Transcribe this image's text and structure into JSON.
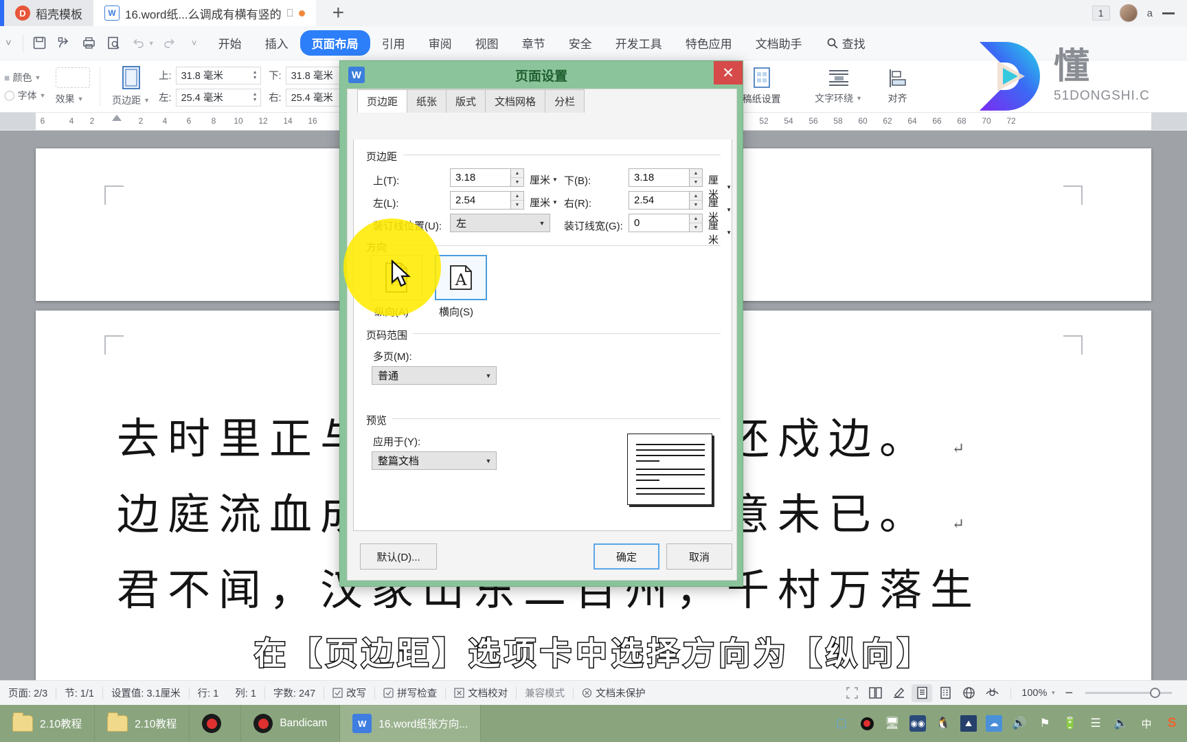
{
  "tabbar": {
    "brand_tab": "稻壳模板",
    "doc_tab": "16.word纸...么调成有横有竖的",
    "new_tab_label": "+",
    "notif_count": "1",
    "user_label": "a"
  },
  "ribbon": {
    "tabs": [
      "开始",
      "插入",
      "页面布局",
      "引用",
      "审阅",
      "视图",
      "章节",
      "安全",
      "开发工具",
      "特色应用",
      "文档助手"
    ],
    "active_tab": "页面布局",
    "find_label": "查找"
  },
  "ribbon_body": {
    "color_label": "颜色",
    "font_label": "字体",
    "effect_label": "效果",
    "margin_button": "页边距",
    "top_label": "上:",
    "top_value": "31.8 毫米",
    "bottom_label": "下:",
    "bottom_value": "31.8 毫米",
    "left_label": "左:",
    "left_value": "25.4 毫米",
    "right_label": "右:",
    "right_value": "25.4 毫米",
    "paper_setup": "稿纸设置",
    "text_wrap": "文字环绕",
    "align": "对齐"
  },
  "ruler": {
    "ticks": [
      "6",
      "4",
      "2",
      "2",
      "4",
      "6",
      "8",
      "10",
      "12",
      "14",
      "16",
      "52",
      "54",
      "56",
      "58",
      "60",
      "62",
      "64",
      "66",
      "68",
      "70",
      "72"
    ]
  },
  "document": {
    "lines": [
      "去时里正与裹头，归来头白还戍边。",
      "边庭流血成海水，武皇开边意未已。",
      "君不闻，汉家山东二百州，千村万落生"
    ]
  },
  "caption": "在【页边距】选项卡中选择方向为【纵向】",
  "watermark": {
    "cn": "懂",
    "en": "51DONGSHI.C"
  },
  "dialog": {
    "title": "页面设置",
    "close_label": "✕",
    "tabs": [
      "页边距",
      "纸张",
      "版式",
      "文档网格",
      "分栏"
    ],
    "active_tab": "页边距",
    "margins": {
      "group_title": "页边距",
      "top_label": "上(T):",
      "top_value": "3.18",
      "top_unit": "厘米",
      "bottom_label": "下(B):",
      "bottom_value": "3.18",
      "bottom_unit": "厘米",
      "left_label": "左(L):",
      "left_value": "2.54",
      "left_unit": "厘米",
      "right_label": "右(R):",
      "right_value": "2.54",
      "right_unit": "厘米",
      "gutter_pos_label": "装订线位置(U):",
      "gutter_pos_value": "左",
      "gutter_width_label": "装订线宽(G):",
      "gutter_width_value": "0",
      "gutter_width_unit": "厘米"
    },
    "orientation": {
      "group_title": "方向",
      "portrait_label": "纵向(A)",
      "landscape_label": "横向(S)",
      "selected": "横向(S)",
      "glyph": "A"
    },
    "pages": {
      "group_title": "页码范围",
      "multipage_label": "多页(M):",
      "multipage_value": "普通"
    },
    "preview": {
      "group_title": "预览",
      "apply_to_label": "应用于(Y):",
      "apply_to_value": "整篇文档"
    },
    "buttons": {
      "default": "默认(D)...",
      "ok": "确定",
      "cancel": "取消"
    }
  },
  "statusbar": {
    "page": "页面: 2/3",
    "section": "节: 1/1",
    "setting": "设置值: 3.1厘米",
    "row": "行: 1",
    "col": "列: 1",
    "words": "字数: 247",
    "overwrite": "改写",
    "spellcheck": "拼写检查",
    "proofread": "文档校对",
    "compat": "兼容模式",
    "unprotected": "文档未保护",
    "zoom": "100%"
  },
  "taskbar": {
    "items": [
      {
        "label": "2.10教程",
        "icon": "folder-icon"
      },
      {
        "label": "2.10教程",
        "icon": "folder-icon"
      },
      {
        "label": "",
        "icon": "record-icon"
      },
      {
        "label": "Bandicam",
        "icon": "record-icon"
      },
      {
        "label": "16.word纸张方向...",
        "icon": "wps-icon"
      }
    ],
    "tray": [
      "books-icon",
      "record-icon",
      "monitor-icon",
      "glasses-icon",
      "penguin-icon",
      "picture-icon",
      "cloud-icon",
      "speaker-icon",
      "flag-icon",
      "battery-icon",
      "signal-icon",
      "volume-icon",
      "ime-icon",
      "sogou-icon"
    ],
    "ime_label": "中",
    "sogou_label": "S"
  },
  "colors": {
    "accent": "#2d7ff9",
    "dialog_frame": "#8bc49a",
    "close_red": "#d64a4a",
    "highlight": "#ffeb00",
    "taskbar": "#8aa57e"
  }
}
